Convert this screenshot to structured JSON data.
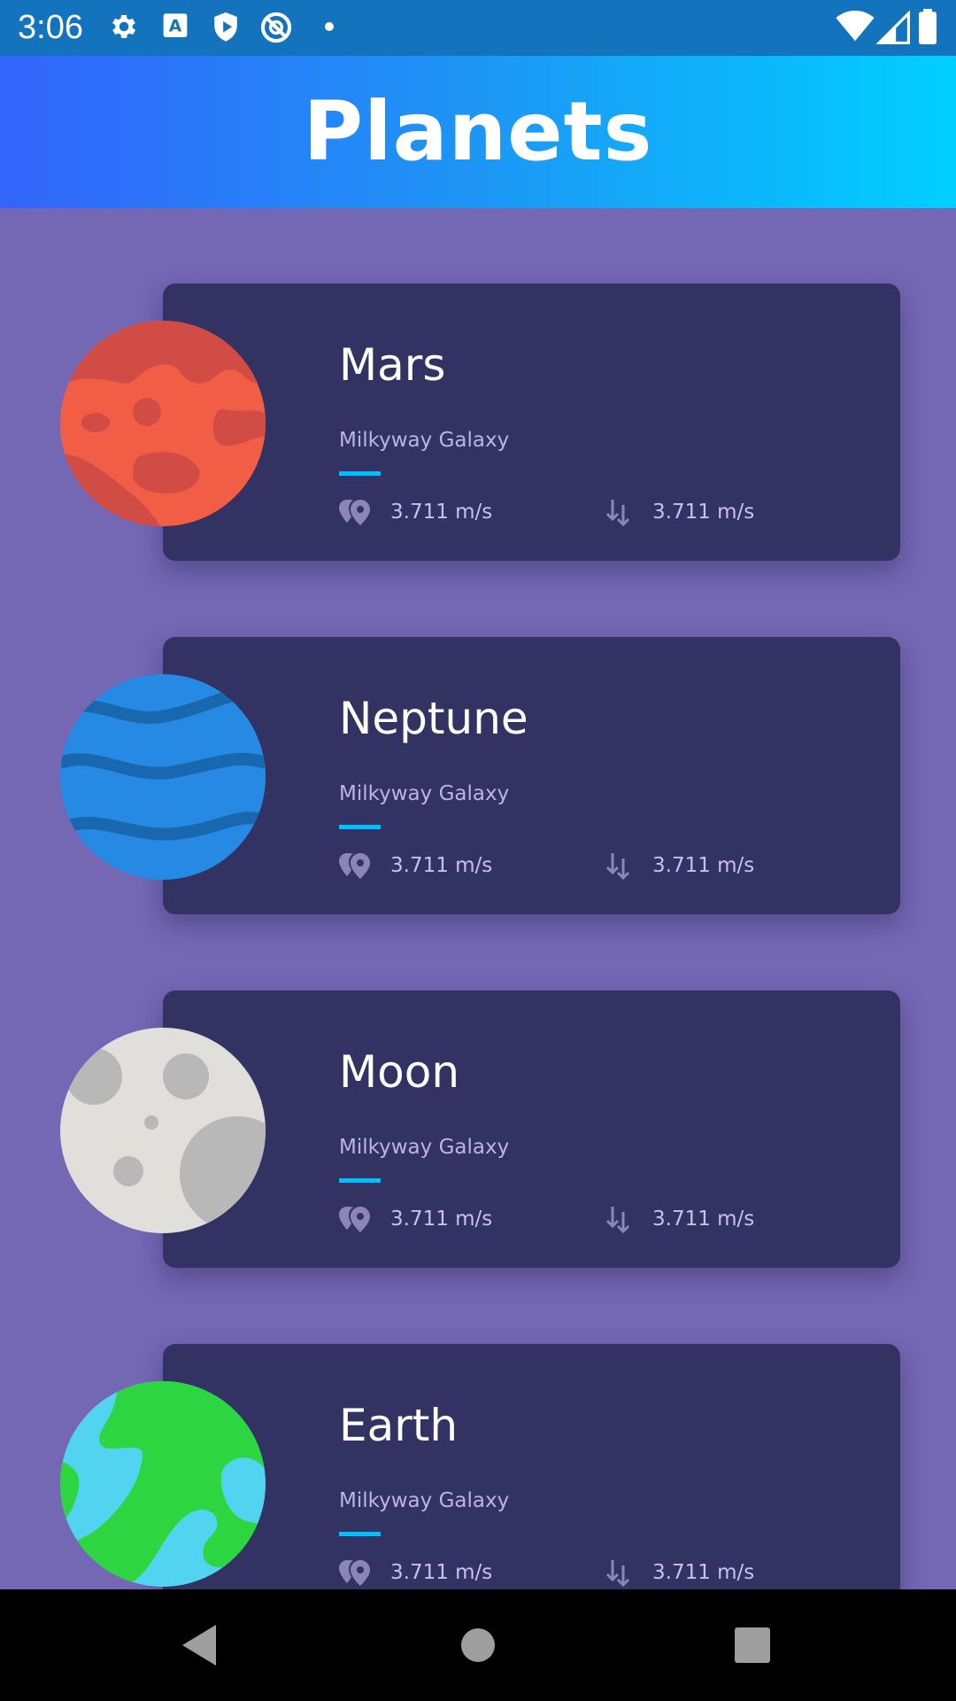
{
  "status_bar": {
    "time": "3:06",
    "left_icons": [
      "gear-icon",
      "text-a-icon",
      "play-shield-icon",
      "no-disturb-icon",
      "dot-icon"
    ],
    "right_icons": [
      "wifi-icon",
      "signal-icon",
      "battery-icon"
    ]
  },
  "app_bar": {
    "title": "Planets",
    "gradient": [
      "#3364fb",
      "#00cfff"
    ]
  },
  "planets": [
    {
      "name": "Mars",
      "galaxy": "Milkyway Galaxy",
      "distance": "3.711 m/s",
      "gravity": "3.711 m/s",
      "image": "mars-icon"
    },
    {
      "name": "Neptune",
      "galaxy": "Milkyway Galaxy",
      "distance": "3.711 m/s",
      "gravity": "3.711 m/s",
      "image": "neptune-icon"
    },
    {
      "name": "Moon",
      "galaxy": "Milkyway Galaxy",
      "distance": "3.711 m/s",
      "gravity": "3.711 m/s",
      "image": "moon-icon"
    },
    {
      "name": "Earth",
      "galaxy": "Milkyway Galaxy",
      "distance": "3.711 m/s",
      "gravity": "3.711 m/s",
      "image": "earth-icon"
    }
  ],
  "colors": {
    "background": "#7467b4",
    "card": "#333363",
    "accent": "#00bfff"
  },
  "nav_bar": {
    "buttons": [
      "back-icon",
      "home-icon",
      "recents-icon"
    ]
  }
}
